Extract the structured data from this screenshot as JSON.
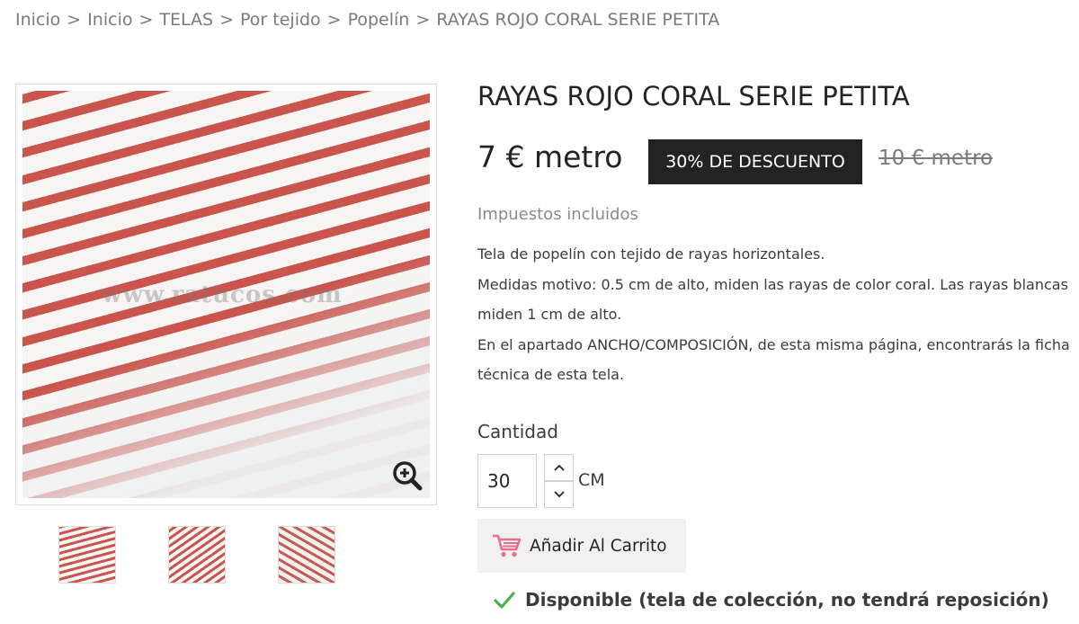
{
  "breadcrumb": {
    "items": [
      "Inicio",
      "Inicio",
      "TELAS",
      "Por tejido",
      "Popelín",
      "RAYAS ROJO CORAL SERIE PETITA"
    ],
    "separator": ">"
  },
  "gallery": {
    "watermark": "www.ratucos.com",
    "zoom_icon": "zoom-in-icon",
    "stripe_colors": [
      "#c9554c",
      "#f7f5f3"
    ]
  },
  "product": {
    "title": "RAYAS ROJO CORAL SERIE PETITA",
    "price": "7 € metro",
    "discount_badge": "30% DE DESCUENTO",
    "old_price": "10 € metro",
    "tax_note": "Impuestos incluidos",
    "description": [
      "Tela de popelín con tejido de rayas horizontales.",
      "Medidas motivo: 0.5 cm de alto, miden las rayas de color coral. Las rayas blancas miden 1 cm de alto.",
      "En el apartado ANCHO/COMPOSICIÓN, de esta misma página, encontrarás la ficha técnica de esta tela."
    ]
  },
  "quantity": {
    "label": "Cantidad",
    "value": "30",
    "unit": "CM"
  },
  "cart": {
    "button_label": "Añadir Al Carrito",
    "icon": "shopping-cart-icon",
    "icon_color": "#e8708a"
  },
  "availability": {
    "text": "Disponible (tela de colección, no tendrá reposición)",
    "icon": "check-icon",
    "icon_color": "#4caf50"
  }
}
